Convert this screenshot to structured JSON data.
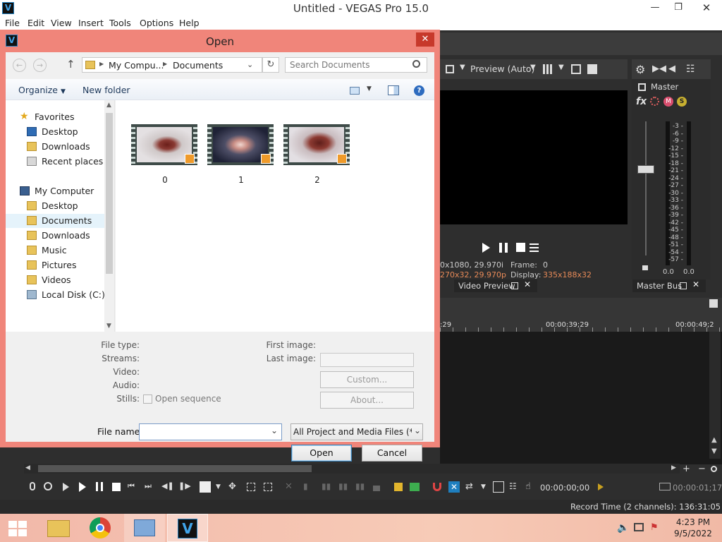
{
  "app": {
    "title": "Untitled - VEGAS Pro 15.0",
    "menu": [
      "File",
      "Edit",
      "View",
      "Insert",
      "Tools",
      "Options",
      "Help"
    ]
  },
  "preview": {
    "mode_label": "Preview (Auto)",
    "project_info": "0x1080, 29.970i",
    "preview_info": "270x32, 29.970p",
    "frame_label": "Frame:",
    "frame_value": "0",
    "display_label": "Display:",
    "display_value": "335x188x32",
    "tab_label": "Video Preview"
  },
  "master_bus": {
    "label": "Master",
    "tab_label": "Master Bus",
    "meter_scale": [
      "3",
      "6",
      "9",
      "12",
      "15",
      "18",
      "21",
      "24",
      "27",
      "30",
      "33",
      "36",
      "39",
      "42",
      "45",
      "48",
      "51",
      "54",
      "57"
    ],
    "left_value": "0.0",
    "right_value": "0.0"
  },
  "timeline": {
    "ruler": [
      ":29",
      "00:00:39;29",
      "00:00:49;2"
    ],
    "time_display": "00:00:00;00",
    "end_time": "00:00:01;17"
  },
  "status": {
    "record_time": "Record Time (2 channels): 136:31:05"
  },
  "dialog": {
    "title": "Open",
    "breadcrumb": [
      "My Compu...",
      "Documents"
    ],
    "search_placeholder": "Search Documents",
    "organize_label": "Organize",
    "new_folder_label": "New folder",
    "nav": {
      "favorites_label": "Favorites",
      "favorites": [
        "Desktop",
        "Downloads",
        "Recent places"
      ],
      "computer_label": "My Computer",
      "computer": [
        "Desktop",
        "Documents",
        "Downloads",
        "Music",
        "Pictures",
        "Videos",
        "Local Disk (C:)"
      ]
    },
    "files": [
      "0",
      "1",
      "2"
    ],
    "details": {
      "file_type": "File type:",
      "streams": "Streams:",
      "video": "Video:",
      "audio": "Audio:",
      "stills": "Stills:",
      "open_sequence": "Open sequence",
      "first_image": "First image:",
      "last_image": "Last image:",
      "custom_button": "Custom...",
      "about_button": "About..."
    },
    "filename_label": "File name:",
    "filename_value": "",
    "filetype_value": "All Project and Media Files (*.ve",
    "open_button": "Open",
    "cancel_button": "Cancel"
  },
  "taskbar": {
    "time": "4:23 PM",
    "date": "9/5/2022"
  },
  "colors": {
    "dialog_frame": "#f0857a",
    "close_button": "#c7392b",
    "orange_info": "#e88a58",
    "vegas_blue": "#1f7fbf"
  }
}
